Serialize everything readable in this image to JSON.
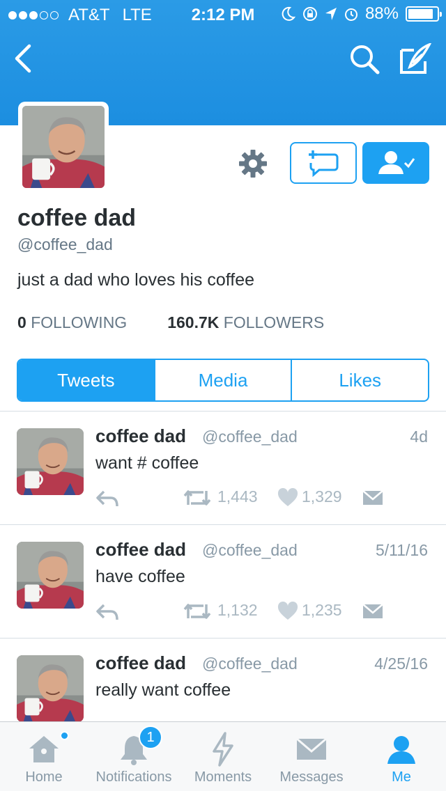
{
  "status_bar": {
    "carrier": "AT&T",
    "network": "LTE",
    "time": "2:12 PM",
    "battery": "88%",
    "battery_level": 0.88
  },
  "profile": {
    "name": "coffee dad",
    "handle": "@coffee_dad",
    "bio": "just a dad who loves his coffee",
    "following_count": "0",
    "following_label": "FOLLOWING",
    "followers_count": "160.7K",
    "followers_label": "FOLLOWERS"
  },
  "tabs": [
    {
      "label": "Tweets",
      "active": true
    },
    {
      "label": "Media",
      "active": false
    },
    {
      "label": "Likes",
      "active": false
    }
  ],
  "tweets": [
    {
      "name": "coffee dad",
      "handle": "@coffee_dad",
      "date": "4d",
      "text": "want # coffee",
      "retweets": "1,443",
      "likes": "1,329"
    },
    {
      "name": "coffee dad",
      "handle": "@coffee_dad",
      "date": "5/11/16",
      "text": "have coffee",
      "retweets": "1,132",
      "likes": "1,235"
    },
    {
      "name": "coffee dad",
      "handle": "@coffee_dad",
      "date": "4/25/16",
      "text": "really want coffee",
      "retweets": "",
      "likes": ""
    }
  ],
  "tabbar": [
    {
      "label": "Home",
      "icon": "home-icon"
    },
    {
      "label": "Notifications",
      "icon": "bell-icon",
      "badge": "1"
    },
    {
      "label": "Moments",
      "icon": "lightning-icon"
    },
    {
      "label": "Messages",
      "icon": "envelope-icon"
    },
    {
      "label": "Me",
      "icon": "person-icon",
      "active": true
    }
  ],
  "colors": {
    "accent": "#1da1f2",
    "header": "#2196e8",
    "muted": "#8899a6"
  }
}
